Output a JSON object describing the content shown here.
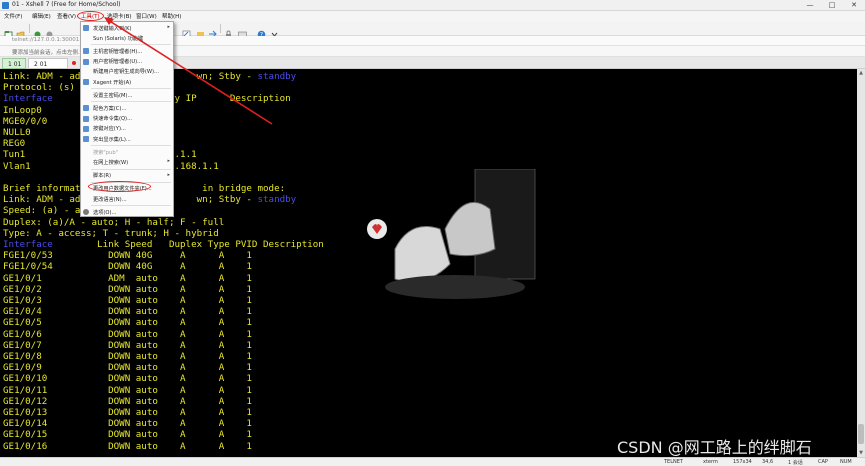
{
  "window": {
    "title": "01 - Xshell 7 (Free for Home/School)",
    "minimize": "—",
    "maximize": "□",
    "close": "✕"
  },
  "menu": {
    "items": [
      "文件(F)",
      "编辑(E)",
      "查看(V)",
      "工具(T)",
      "选项卡(B)",
      "窗口(W)",
      "帮助(H)"
    ],
    "active_index": 3
  },
  "addressbar": {
    "text": "telnet://127.0.0.1:30001"
  },
  "hintbar": {
    "text": "要添加当前会话，点击左侧..."
  },
  "tabs": [
    {
      "label": "1 01"
    },
    {
      "label": "2 01"
    }
  ],
  "dropdown": {
    "items": [
      {
        "label": "发送键输入到(K)",
        "arrow": "▸",
        "disabled": false,
        "icon": "keyboard-icon"
      },
      {
        "label": "Sun (Solaris) 功能键",
        "arrow": "",
        "disabled": false,
        "icon": ""
      },
      {
        "sep": true
      },
      {
        "label": "主机密钥管理者(H)...",
        "arrow": "",
        "disabled": false,
        "icon": "key-icon"
      },
      {
        "label": "用户密钥管理者(U)...",
        "arrow": "",
        "disabled": false,
        "icon": "user-key-icon"
      },
      {
        "label": "新建用户密钥生成向导(W)...",
        "arrow": "",
        "disabled": false,
        "icon": ""
      },
      {
        "label": "Xagent 开始(A)",
        "arrow": "",
        "disabled": false,
        "icon": "agent-icon"
      },
      {
        "sep": true
      },
      {
        "label": "设置主密码(M)...",
        "arrow": "",
        "disabled": false,
        "icon": ""
      },
      {
        "sep": true
      },
      {
        "label": "配色方案(C)...",
        "arrow": "",
        "disabled": false,
        "icon": "palette-icon"
      },
      {
        "label": "快速命令集(Q)...",
        "arrow": "",
        "disabled": false,
        "icon": "command-icon"
      },
      {
        "label": "按键对应(Y)...",
        "arrow": "",
        "disabled": false,
        "icon": "keymap-icon"
      },
      {
        "label": "突出显示集(L)...",
        "arrow": "",
        "disabled": false,
        "icon": "highlight-icon"
      },
      {
        "sep": true
      },
      {
        "label": "搜索\"pub\"",
        "arrow": "",
        "disabled": true,
        "icon": ""
      },
      {
        "label": "在网上搜索(W)",
        "arrow": "▸",
        "disabled": false,
        "icon": ""
      },
      {
        "sep": true
      },
      {
        "label": "脚本(R)",
        "arrow": "▸",
        "disabled": false,
        "icon": ""
      },
      {
        "sep": true
      },
      {
        "label": "更改用户数据文件夹(F)...",
        "arrow": "",
        "disabled": false,
        "icon": ""
      },
      {
        "label": "更改语言(N)...",
        "arrow": "",
        "disabled": false,
        "icon": ""
      },
      {
        "sep": true
      },
      {
        "label": "选项(O)...",
        "arrow": "",
        "disabled": false,
        "icon": "gear-icon"
      }
    ]
  },
  "terminal": {
    "lines": [
      {
        "parts": [
          [
            "Link: ADM - ad",
            "y"
          ],
          [
            "                     ",
            "y"
          ],
          [
            "wn; Stby - ",
            "y"
          ],
          [
            "standby",
            "b"
          ]
        ]
      },
      {
        "parts": [
          [
            "Protocol: (s)",
            "y"
          ]
        ]
      },
      {
        "parts": [
          [
            "Interface",
            "b"
          ],
          [
            "            ",
            "y"
          ],
          [
            "col Primary IP      Description",
            "y"
          ]
        ]
      },
      {
        "parts": [
          [
            "InLoop0",
            "y"
          ],
          [
            "                     ",
            "y"
          ],
          [
            "--",
            "y"
          ]
        ]
      },
      {
        "parts": [
          [
            "MGE0/0/0",
            "y"
          ],
          [
            "                    ",
            "y"
          ],
          [
            "--",
            "y"
          ]
        ]
      },
      {
        "parts": [
          [
            "NULL0",
            "y"
          ],
          [
            "                       ",
            "y"
          ],
          [
            "--",
            "y"
          ]
        ]
      },
      {
        "parts": [
          [
            "REG0",
            "y"
          ],
          [
            "                        ",
            "y"
          ],
          [
            "--",
            "y"
          ]
        ]
      },
      {
        "parts": [
          [
            "Tun1",
            "y"
          ],
          [
            "                        ",
            "y"
          ],
          [
            "1.1.1.1",
            "y"
          ]
        ]
      },
      {
        "parts": [
          [
            "Vlan1",
            "y"
          ],
          [
            "                       ",
            "y"
          ],
          [
            "192.168.1.1",
            "y"
          ]
        ]
      },
      {
        "parts": [
          [
            "",
            "y"
          ]
        ]
      },
      {
        "parts": [
          [
            "Brief informat",
            "y"
          ],
          [
            "                     ",
            "y"
          ],
          [
            " in bridge mode:",
            "y"
          ]
        ]
      },
      {
        "parts": [
          [
            "Link: ADM - ad",
            "y"
          ],
          [
            "                     ",
            "y"
          ],
          [
            "wn; Stby - ",
            "y"
          ],
          [
            "standby",
            "b"
          ]
        ]
      },
      {
        "parts": [
          [
            "Speed: (a) - a",
            "y"
          ]
        ]
      },
      {
        "parts": [
          [
            "Duplex: (a)/A - auto; H - half; F - full",
            "y"
          ]
        ]
      },
      {
        "parts": [
          [
            "Type: A - access; T - trunk; H - hybrid",
            "y"
          ]
        ]
      },
      {
        "parts": [
          [
            "Interface",
            "b"
          ],
          [
            "        Link Speed   Duplex Type PVID Description",
            "y"
          ]
        ]
      },
      {
        "parts": [
          [
            "FGE1/0/53          DOWN 40G     A      A    1",
            "y"
          ]
        ]
      },
      {
        "parts": [
          [
            "FGE1/0/54          DOWN 40G     A      A    1",
            "y"
          ]
        ]
      },
      {
        "parts": [
          [
            "GE1/0/1            ADM  auto    A      A    1",
            "y"
          ]
        ]
      },
      {
        "parts": [
          [
            "GE1/0/2            DOWN auto    A      A    1",
            "y"
          ]
        ]
      },
      {
        "parts": [
          [
            "GE1/0/3            DOWN auto    A      A    1",
            "y"
          ]
        ]
      },
      {
        "parts": [
          [
            "GE1/0/4            DOWN auto    A      A    1",
            "y"
          ]
        ]
      },
      {
        "parts": [
          [
            "GE1/0/5            DOWN auto    A      A    1",
            "y"
          ]
        ]
      },
      {
        "parts": [
          [
            "GE1/0/6            DOWN auto    A      A    1",
            "y"
          ]
        ]
      },
      {
        "parts": [
          [
            "GE1/0/7            DOWN auto    A      A    1",
            "y"
          ]
        ]
      },
      {
        "parts": [
          [
            "GE1/0/8            DOWN auto    A      A    1",
            "y"
          ]
        ]
      },
      {
        "parts": [
          [
            "GE1/0/9            DOWN auto    A      A    1",
            "y"
          ]
        ]
      },
      {
        "parts": [
          [
            "GE1/0/10           DOWN auto    A      A    1",
            "y"
          ]
        ]
      },
      {
        "parts": [
          [
            "GE1/0/11           DOWN auto    A      A    1",
            "y"
          ]
        ]
      },
      {
        "parts": [
          [
            "GE1/0/12           DOWN auto    A      A    1",
            "y"
          ]
        ]
      },
      {
        "parts": [
          [
            "GE1/0/13           DOWN auto    A      A    1",
            "y"
          ]
        ]
      },
      {
        "parts": [
          [
            "GE1/0/14           DOWN auto    A      A    1",
            "y"
          ]
        ]
      },
      {
        "parts": [
          [
            "GE1/0/15           DOWN auto    A      A    1",
            "y"
          ]
        ]
      },
      {
        "parts": [
          [
            "GE1/0/16           DOWN auto    A      A    1",
            "y"
          ]
        ]
      }
    ]
  },
  "statusbar": {
    "protocol": "TELNET",
    "terminal": "xterm",
    "size": "157x34",
    "position": "34,6",
    "sessions": "1 会话",
    "caps": "CAP",
    "num": "NUM"
  },
  "watermark": "CSDN @网工路上的绊脚石",
  "colors": {
    "yellow": "#e6e62a",
    "blue": "#4a4ae6",
    "annotation_red": "#e02020"
  }
}
